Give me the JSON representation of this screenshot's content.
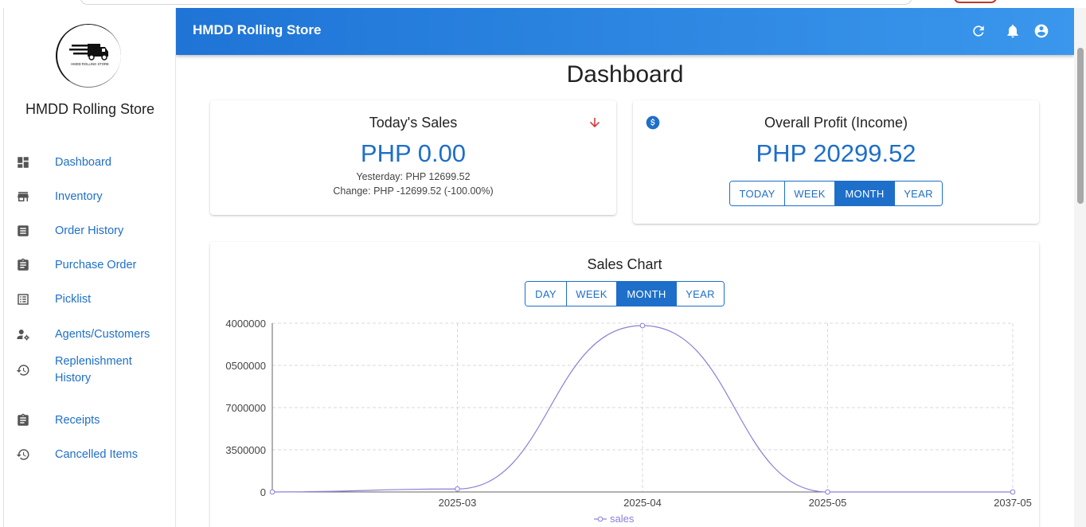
{
  "sidebar": {
    "logo_text": "HMDD ROLLING STORE",
    "brand": "HMDD Rolling Store",
    "items": [
      {
        "label": "Dashboard",
        "icon": "dashboard-icon"
      },
      {
        "label": "Inventory",
        "icon": "store-icon"
      },
      {
        "label": "Order History",
        "icon": "receipt-icon"
      },
      {
        "label": "Purchase Order",
        "icon": "clipboard-icon"
      },
      {
        "label": "Picklist",
        "icon": "list-icon"
      },
      {
        "label": "Agents/Customers",
        "icon": "person-gear-icon"
      },
      {
        "label": "Replenishment History",
        "icon": "history-icon"
      },
      {
        "label": "Receipts",
        "icon": "clipboard-icon"
      },
      {
        "label": "Cancelled Items",
        "icon": "history-icon"
      }
    ]
  },
  "appbar": {
    "title": "HMDD Rolling Store",
    "icons": [
      "refresh-icon",
      "bell-icon",
      "account-icon"
    ]
  },
  "page": {
    "title": "Dashboard"
  },
  "todays_sales": {
    "title": "Today's Sales",
    "value": "PHP 0.00",
    "yesterday": "Yesterday: PHP 12699.52",
    "change": "Change: PHP -12699.52 (-100.00%)",
    "trend_icon": "arrow-down-icon",
    "trend_color": "#d32f2f"
  },
  "overall_profit": {
    "title": "Overall Profit (Income)",
    "value": "PHP 20299.52",
    "icon": "dollar-circle-icon",
    "periods": [
      "TODAY",
      "WEEK",
      "MONTH",
      "YEAR"
    ],
    "active_period": "MONTH"
  },
  "sales_chart": {
    "title": "Sales Chart",
    "periods": [
      "DAY",
      "WEEK",
      "MONTH",
      "YEAR"
    ],
    "active_period": "MONTH"
  },
  "chart_data": {
    "type": "line",
    "title": "Sales Chart",
    "x": [
      "",
      "2025-03",
      "2025-04",
      "2025-05",
      "2037-05"
    ],
    "series": [
      {
        "name": "sales",
        "values": [
          0,
          250000,
          13800000,
          0,
          0
        ],
        "color": "#8a7fd6"
      }
    ],
    "ylim": [
      0,
      14000000
    ],
    "yticks": [
      0,
      3500000,
      7000000,
      10500000,
      14000000
    ],
    "ytick_labels": [
      "0",
      "3500000",
      "7000000",
      "0500000",
      "4000000"
    ],
    "grid": true,
    "legend": "bottom-center",
    "smooth": true
  },
  "colors": {
    "accent": "#1e6fc9",
    "appbar_start": "#1f74d6",
    "appbar_end": "#3a97ec",
    "line": "#8a7fd6"
  }
}
